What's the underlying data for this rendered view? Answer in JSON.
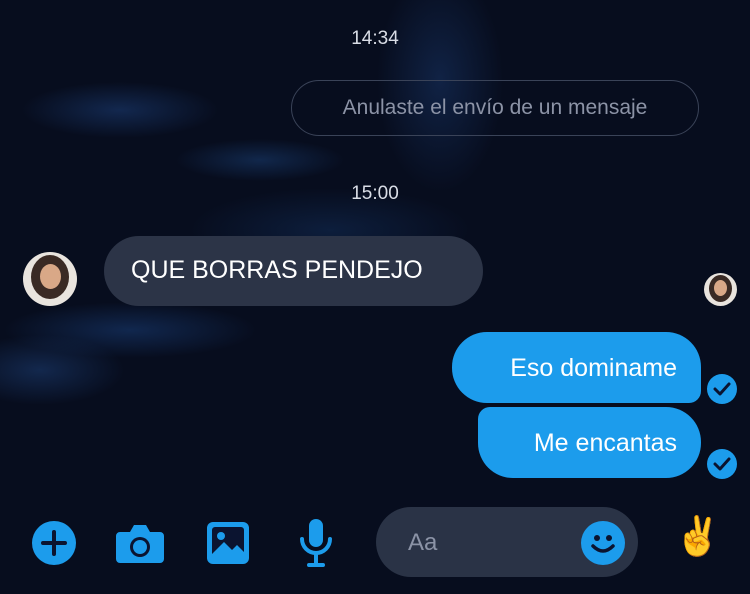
{
  "colors": {
    "accent": "#1c9cec",
    "background": "#070d1e",
    "incoming_bubble": "#2c3447",
    "composer": "#2a3346"
  },
  "messages": {
    "timestamp_1": "14:34",
    "unsent_notice": "Anulaste el envío de un mensaje",
    "timestamp_2": "15:00",
    "incoming_1": "QUE BORRAS PENDEJO",
    "outgoing_1": "Eso dominame",
    "outgoing_2": "Me encantas"
  },
  "composer": {
    "placeholder": "Aa",
    "quick_reaction": "✌️"
  },
  "icons": {
    "add": "plus-icon",
    "camera": "camera-icon",
    "gallery": "image-icon",
    "voice": "microphone-icon",
    "emoji": "smiley-icon",
    "read_receipt": "checkmark-icon"
  }
}
